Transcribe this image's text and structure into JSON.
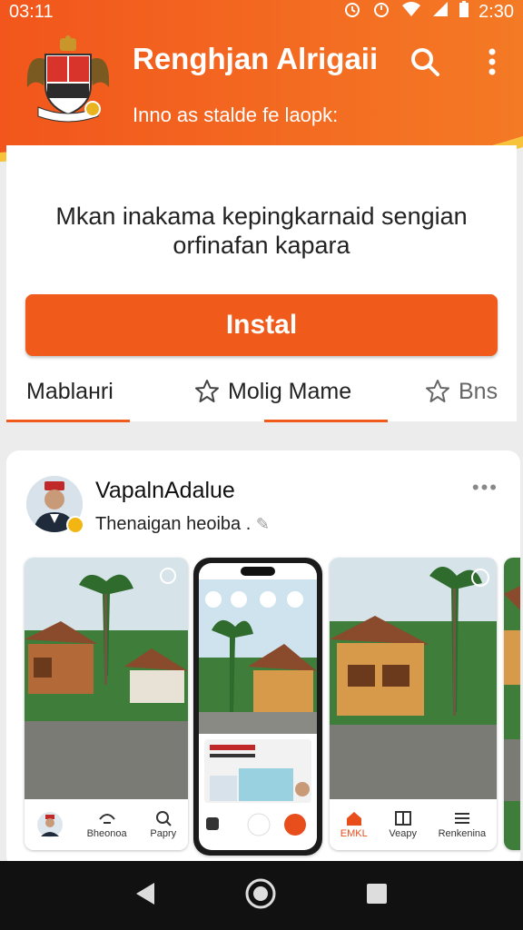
{
  "status": {
    "time": "03:11",
    "clock": "2:30"
  },
  "header": {
    "title": "Renghjan Alrigaii",
    "subtitle": "Inno as stalde fe laopk:",
    "search_icon": "search-icon",
    "menu_icon": "more-vert-icon"
  },
  "install": {
    "description_line1": "Mkan inakama kepingkarnaid sengian",
    "description_line2": "orfinafan kapara",
    "button_label": "Instal"
  },
  "tabs": [
    {
      "label": "Mablaнri",
      "icon": ""
    },
    {
      "label": "Molig Mame",
      "icon": "star-icon"
    },
    {
      "label": "Bns",
      "icon": "star-icon"
    }
  ],
  "post": {
    "author": "VapalnAdalue",
    "subtitle": "Thenaigan heoiba .",
    "more": "•••"
  },
  "screens": {
    "left_nav": [
      "Bheonoa",
      "Papry"
    ],
    "right_nav": [
      "EMKL",
      "Veapy",
      "Renkenina"
    ]
  },
  "colors": {
    "brand": "#f05a1a",
    "header_orange": "#f26a1f",
    "accent_yellow": "#f7b733"
  }
}
